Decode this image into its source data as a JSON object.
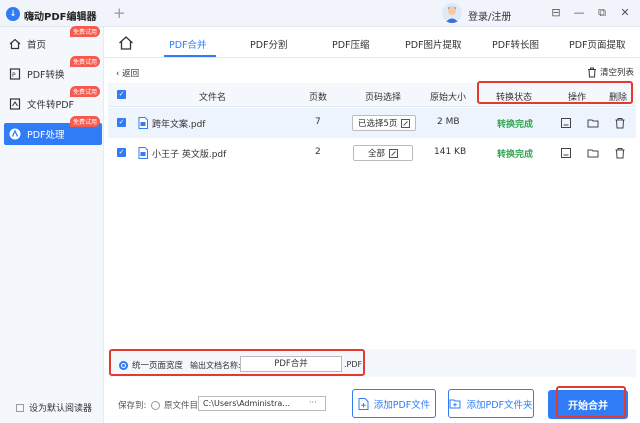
{
  "app": {
    "logo_text": "↓",
    "title": "嗨动PDF编辑器",
    "new_tab": "+",
    "login": "登录/注册",
    "window_controls": [
      "⊟",
      "—",
      "⧉",
      "✕"
    ]
  },
  "sidebar": {
    "items": [
      {
        "label": "首页",
        "icon": "home-icon",
        "badge": "免费试用"
      },
      {
        "label": "PDF转换",
        "icon": "convert-icon",
        "badge": "免费试用"
      },
      {
        "label": "文件转PDF",
        "icon": "file-to-pdf-icon",
        "badge": "免费试用"
      },
      {
        "label": "PDF处理",
        "icon": "pdf-process-icon",
        "badge": "免费试用",
        "active": true
      }
    ],
    "set_default": "设为默认阅读器"
  },
  "tabs": [
    "PDF合并",
    "PDF分割",
    "PDF压缩",
    "PDF图片提取",
    "PDF转长图",
    "PDF页面提取"
  ],
  "toolbar": {
    "back": "返回",
    "clear": "清空列表"
  },
  "table": {
    "headers": [
      "文件名",
      "页数",
      "页码选择",
      "原始大小",
      "转换状态",
      "操作",
      "删除"
    ],
    "rows": [
      {
        "name": "跨年文案.pdf",
        "pages": "7",
        "page_select": "已选择5页",
        "size": "2 MB",
        "status": "转换完成"
      },
      {
        "name": "小王子 英文版.pdf",
        "pages": "2",
        "page_select": "全部",
        "size": "141 KB",
        "status": "转换完成"
      }
    ]
  },
  "options": {
    "unify_width": "统一页面宽度",
    "output_name_label": "输出文档名称:",
    "output_name_value": "PDF合并",
    "ext": ".PDF"
  },
  "footer": {
    "save_to": "保存到:",
    "source_dir": "原文件目录",
    "custom_path": "C:\\Users\\Administra...",
    "more": "···",
    "add_file": "添加PDF文件",
    "add_folder": "添加PDF文件夹",
    "start": "开始合并"
  },
  "colors": {
    "accent": "#2f7cf6",
    "badge": "#f55a4e",
    "status_done": "#33a853",
    "highlight_box": "#e03b2e"
  }
}
